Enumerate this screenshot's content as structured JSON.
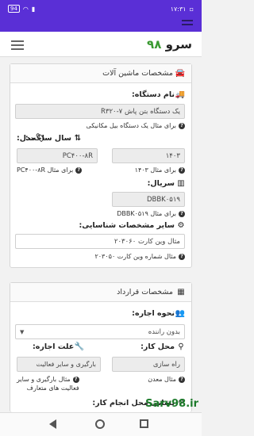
{
  "status": {
    "time": "۱۷:۳۱",
    "battery": "94"
  },
  "brand": {
    "name": "سرو",
    "number": "۹۸"
  },
  "machine": {
    "title": "مشخصات ماشین آلات",
    "device_label": "نام دستگاه:",
    "device_value": "یک دستگاه بتن پاش R۳۲۰-۷",
    "device_hint": "برای مثال یک دستگاه بیل مکانیکی",
    "year_label": "سال ساخت:",
    "year_value": "۱۴۰۳",
    "year_hint": "برای مثال ۱۴۰۳",
    "model_label": "مدل:",
    "model_value": "PC۴۰۰-۸R",
    "model_hint": "برای مثال PC۴۰۰-۸R",
    "serial_label": "سریال:",
    "serial_value": "DBBK۰۵۱۹",
    "serial_hint": "برای مثال DBBK۰۵۱۹",
    "ident_label": "سایر مشخصات شناسایی:",
    "ident_value": "مثال وین کارت ۲۰۳۰۶۰",
    "ident_hint": "مثال شماره وین کارت ۲۰۳۰۵۰"
  },
  "contract": {
    "title": "مشخصات قرارداد",
    "rent_type_label": "نحوه اجاره:",
    "rent_type_value": "بدون راننده",
    "location_label": "محل کار:",
    "location_value": "راه سازی",
    "location_hint": "مثال معدن",
    "reason_label": "علت اجاره:",
    "reason_value": "بارگیری و سایر فعالیت",
    "reason_hint_1": "مثال بارگیری و سایر",
    "reason_hint_2": "فعالیت های متعارف",
    "address_label": "نشانی محل انجام کار:"
  },
  "watermark": "Sarv98.ir"
}
